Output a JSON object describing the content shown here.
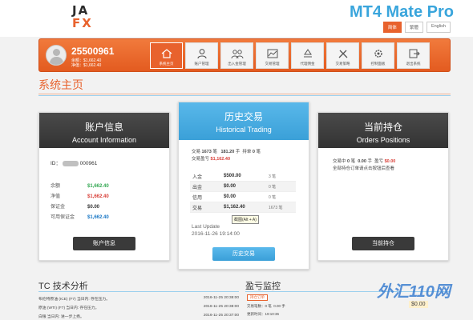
{
  "header": {
    "logo_line1": "JA",
    "logo_line2": "FX",
    "brand": "MT4 Mate Pro",
    "lang": [
      "简体",
      "繁體",
      "English"
    ]
  },
  "account": {
    "number": "25500961",
    "balance_line": "余额：$1,662.40",
    "equity_line": "净值：$1,662.40"
  },
  "nav": [
    {
      "label": "系统主页",
      "icon": "home-icon",
      "active": true
    },
    {
      "label": "账户管理",
      "icon": "user-icon"
    },
    {
      "label": "出入金管理",
      "icon": "people-icon"
    },
    {
      "label": "交易管理",
      "icon": "chart-icon"
    },
    {
      "label": "代理佣金",
      "icon": "recycle-icon"
    },
    {
      "label": "交易策略",
      "icon": "tools-icon"
    },
    {
      "label": "控制面板",
      "icon": "gear-icon"
    },
    {
      "label": "退出系统",
      "icon": "logout-icon"
    }
  ],
  "page_title": "系统主页",
  "account_card": {
    "title_cn": "账户信息",
    "title_en": "Account Information",
    "id_label": "ID：",
    "id_tail": "000961",
    "rows": [
      {
        "k": "余额",
        "v": "$1,662.40",
        "color": "g"
      },
      {
        "k": "净值",
        "v": "$1,662.40",
        "color": "r"
      },
      {
        "k": "保证金",
        "v": "$0.00",
        "color": ""
      },
      {
        "k": "可用保证金",
        "v": "$1,662.40",
        "color": "b"
      }
    ],
    "button": "账户信息"
  },
  "history_card": {
    "title_cn": "历史交易",
    "title_en": "Historical Trading",
    "stats1_a": "交易",
    "stats1_b": "1673",
    "stats1_c": "笔",
    "stats1_d": "181.20",
    "stats1_e": "手",
    "stats1_f": "持单",
    "stats1_g": "0",
    "stats1_h": "笔",
    "stats2_a": "交易盈亏",
    "stats2_b": "$1,162.40",
    "table": [
      {
        "c1": "入金",
        "c2": "$500.00",
        "c3": "3 笔"
      },
      {
        "c1": "出金",
        "c2": "$0.00",
        "c3": "0 笔"
      },
      {
        "c1": "信用",
        "c2": "$0.00",
        "c3": "0 笔"
      },
      {
        "c1": "交易",
        "c2": "$1,162.40",
        "c3": "1673 笔"
      }
    ],
    "tooltip": "截图(Alt + A)",
    "last_update_label": "Last Update",
    "last_update": "2016-11-26 19:14:00",
    "button": "历史交易"
  },
  "orders_card": {
    "title_cn": "当前持仓",
    "title_en": "Orders Positions",
    "line1_a": "交易中",
    "line1_b": "0",
    "line1_c": "笔",
    "line1_d": "0.00",
    "line1_e": "手",
    "line1_f": "盈亏",
    "line1_g": "$0.00",
    "line2": "全部持仓订单请点击按钮后查看",
    "button": "当前持仓"
  },
  "tech": {
    "title": "TC 技术分析",
    "items": [
      {
        "text": "布伦特原油 (ICE) (F7) 当日内: 存在压力。",
        "time": "2016-11-25 20:38:00"
      },
      {
        "text": "原油 (WTI) (F7) 当日内: 存在压力。",
        "time": "2016-11-25 20:38:00"
      },
      {
        "text": "白银 当日内: 进一步上扬。",
        "time": "2016-11-25 20:37:00"
      }
    ]
  },
  "monitor": {
    "title": "盈亏监控",
    "badge": "持仓订单",
    "line1_a": "交易笔数：",
    "line1_b": "0 笔",
    "line1_c": "0.00 手",
    "line2_a": "更新时间：",
    "line2_b": "19:10:36"
  },
  "watermark": "外汇110网",
  "watermark_sub": "$0.00"
}
